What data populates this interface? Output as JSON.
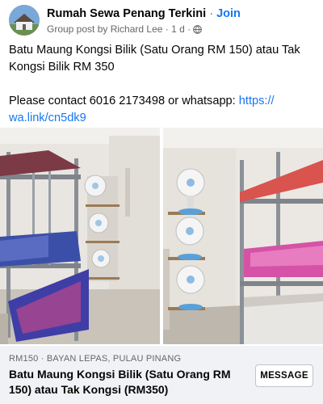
{
  "header": {
    "group_name": "Rumah Sewa Penang Terkini",
    "separator": "·",
    "join_label": "Join",
    "post_meta": "Group post by Richard Lee · 1 d ·",
    "globe_icon": "globe-icon"
  },
  "post": {
    "line1": "Batu Maung Kongsi Bilik (Satu Orang RM 150) atau Tak",
    "line2": "Kongsi Bilik RM 350",
    "contact_prefix": "Please contact 6016 2173498 or whatsapp: ",
    "link_part1": "https://",
    "link_part2": "wa.link/cn5dk9"
  },
  "listing": {
    "meta": "RM150 · BAYAN LEPAS, PULAU PINANG",
    "title": "Batu Maung Kongsi Bilik (Satu Orang RM 150) atau Tak Kongsi (RM350)",
    "message_label": "MESSAGE"
  },
  "colors": {
    "link": "#1877f2",
    "secondary_text": "#65676b",
    "listing_bg": "#f0f2f5"
  }
}
